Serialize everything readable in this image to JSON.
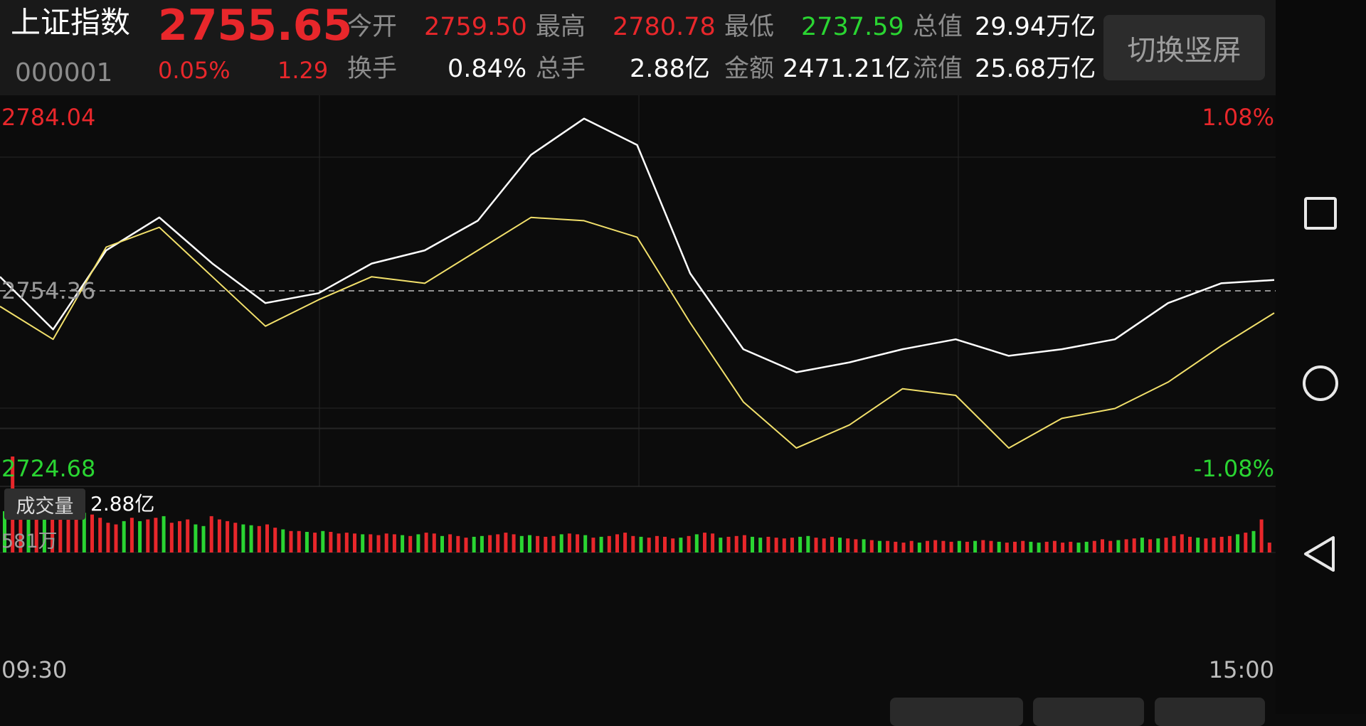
{
  "header": {
    "name": "上证指数",
    "code": "000001",
    "price": "2755.65",
    "change_pct": "0.05%",
    "change": "1.29",
    "open_label": "今开",
    "open": "2759.50",
    "high_label": "最高",
    "high": "2780.78",
    "low_label": "最低",
    "low": "2737.59",
    "mcap_label": "总值",
    "mcap": "29.94万亿",
    "turnover_label": "换手",
    "turnover": "0.84%",
    "vol_label": "总手",
    "vol": "2.88亿",
    "amount_label": "金额",
    "amount": "2471.21亿",
    "float_label": "流值",
    "float": "25.68万亿",
    "toggle_label": "切换竖屏"
  },
  "chart": {
    "y_top": "2784.04",
    "y_mid": "2754.36",
    "y_bottom": "2724.68",
    "pct_top": "1.08%",
    "pct_bottom": "-1.08%",
    "vol_tab": "成交量",
    "vol_total": "2.88亿",
    "vol_max": "581万",
    "time_start": "09:30",
    "time_end": "15:00"
  },
  "colors": {
    "up": "#e8272b",
    "down": "#2ad532",
    "price_line": "#ffffff",
    "avg_line": "#f2e06b"
  },
  "icons": {
    "recent": "square-icon",
    "home": "circle-icon",
    "back": "triangle-back-icon"
  },
  "chart_data": {
    "type": "line",
    "x": [
      "09:30",
      "09:40",
      "09:50",
      "10:00",
      "10:10",
      "10:20",
      "10:30",
      "10:40",
      "10:50",
      "11:00",
      "11:10",
      "11:20",
      "11:30",
      "13:10",
      "13:20",
      "13:30",
      "13:40",
      "13:50",
      "14:00",
      "14:10",
      "14:20",
      "14:30",
      "14:40",
      "14:50",
      "15:00"
    ],
    "series": [
      {
        "values": [
          2756.5,
          2748.5,
          2760.5,
          2765.5,
          2758.5,
          2752.5,
          2754.0,
          2758.5,
          2760.5,
          2765.0,
          2775.0,
          2780.5,
          2776.5,
          2757.0,
          2745.5,
          2742.0,
          2743.5,
          2745.5,
          2747.0,
          2744.5,
          2745.5,
          2747.0,
          2752.5,
          2755.5,
          2756.0
        ]
      },
      {
        "values": [
          2752.0,
          2747.0,
          2761.0,
          2764.0,
          2756.5,
          2749.0,
          2753.0,
          2756.5,
          2755.5,
          2760.5,
          2765.5,
          2765.0,
          2762.5,
          2749.5,
          2737.5,
          2730.5,
          2734.0,
          2739.5,
          2738.5,
          2730.5,
          2735.0,
          2736.5,
          2740.5,
          2746.0,
          2751.0
        ]
      }
    ],
    "ylim": [
      2724.68,
      2784.04
    ],
    "volume": {
      "unit": "万",
      "max": 581,
      "values": [
        250,
        581,
        280,
        260,
        250,
        255,
        250,
        240,
        250,
        255,
        240,
        230,
        210,
        180,
        170,
        190,
        210,
        190,
        200,
        210,
        220,
        180,
        190,
        200,
        170,
        160,
        220,
        200,
        190,
        180,
        170,
        165,
        160,
        170,
        150,
        140,
        130,
        130,
        125,
        120,
        130,
        125,
        115,
        120,
        115,
        110,
        110,
        105,
        115,
        110,
        105,
        100,
        110,
        120,
        115,
        100,
        110,
        100,
        90,
        95,
        100,
        105,
        110,
        120,
        110,
        100,
        105,
        100,
        95,
        100,
        110,
        115,
        110,
        105,
        90,
        95,
        100,
        110,
        120,
        100,
        95,
        90,
        100,
        95,
        85,
        90,
        100,
        110,
        120,
        115,
        90,
        95,
        100,
        105,
        95,
        90,
        95,
        90,
        85,
        90,
        95,
        100,
        90,
        85,
        95,
        90,
        85,
        80,
        80,
        75,
        70,
        70,
        65,
        60,
        70,
        60,
        70,
        75,
        70,
        65,
        70,
        65,
        70,
        75,
        70,
        65,
        60,
        65,
        70,
        65,
        60,
        65,
        70,
        60,
        65,
        60,
        65,
        70,
        80,
        70,
        75,
        80,
        85,
        90,
        80,
        85,
        90,
        100,
        110,
        95,
        90,
        85,
        90,
        95,
        100,
        110,
        120,
        130,
        200,
        60
      ]
    }
  }
}
